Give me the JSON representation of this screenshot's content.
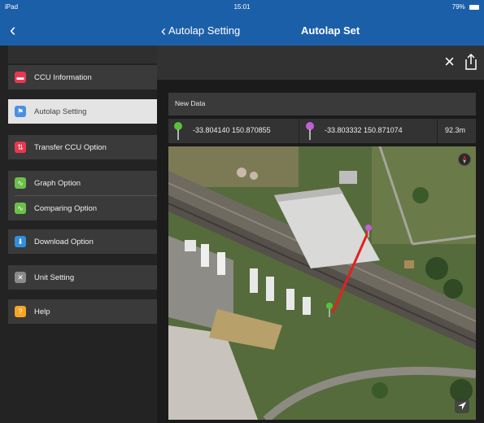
{
  "status_bar": {
    "carrier": "iPad",
    "time": "15:01",
    "battery": "79%"
  },
  "nav": {
    "back_symbol": "‹",
    "back_label": "Autolap Setting",
    "title": "Autolap Set"
  },
  "sidebar": {
    "items": [
      {
        "label": "CCU Information",
        "icon": "ccu-icon",
        "color": "#e8384f"
      },
      {
        "label": "Autolap Setting",
        "icon": "autolap-icon",
        "color": "#4a90e2"
      },
      {
        "label": "Transfer CCU Option",
        "icon": "transfer-icon",
        "color": "#e8384f"
      },
      {
        "label": "Graph Option",
        "icon": "graph-icon",
        "color": "#6cc04a"
      },
      {
        "label": "Comparing Option",
        "icon": "compare-icon",
        "color": "#6cc04a"
      },
      {
        "label": "Download Option",
        "icon": "download-icon",
        "color": "#2f8fe0"
      },
      {
        "label": "Unit Setting",
        "icon": "unit-icon",
        "color": "#8a8a8a"
      },
      {
        "label": "Help",
        "icon": "help-icon",
        "color": "#f5a623"
      }
    ]
  },
  "main": {
    "close_symbol": "×",
    "new_data_label": "New Data",
    "start_coord": "-33.804140  150.870855",
    "end_coord": "-33.803332  150.871074",
    "distance": "92.3m",
    "start_pin_color": "#55c23a",
    "end_pin_color": "#c35fd6",
    "line_color": "#e52020"
  }
}
